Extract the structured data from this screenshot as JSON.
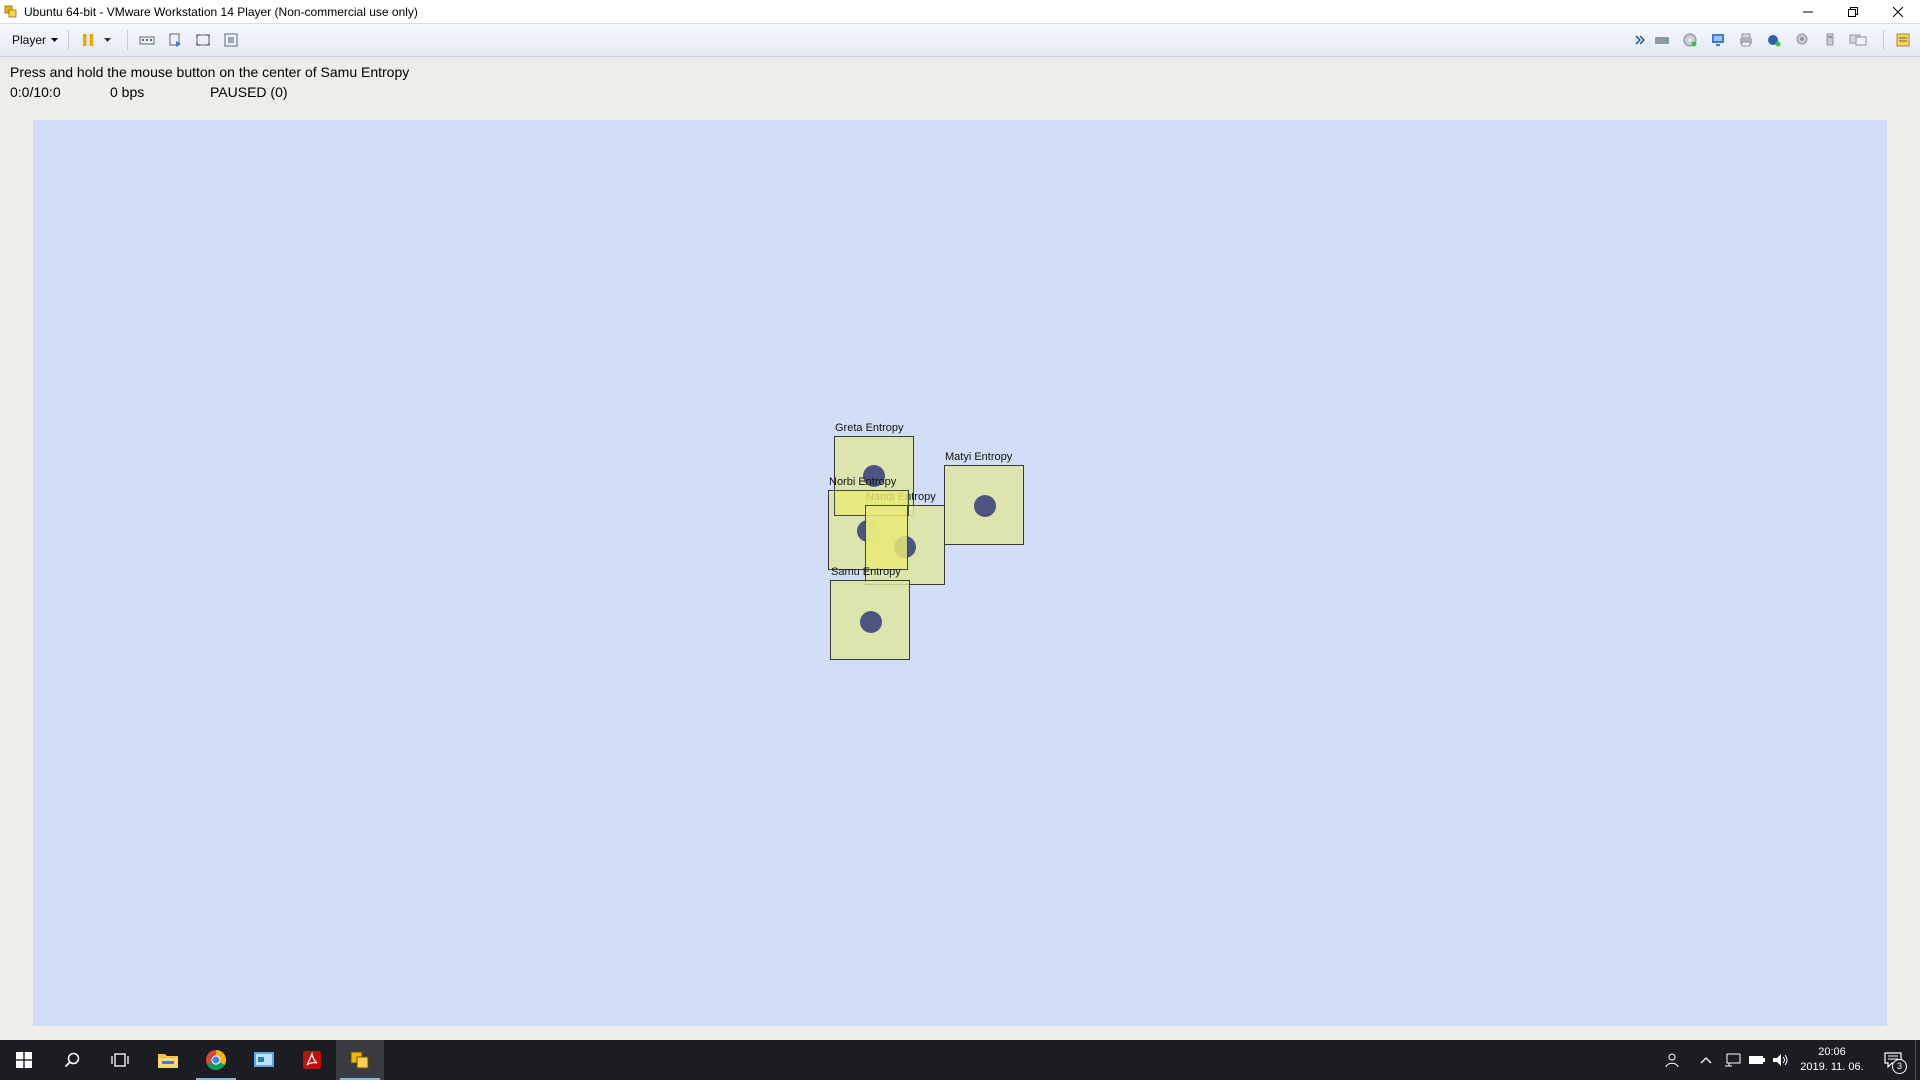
{
  "window": {
    "title": "Ubuntu 64-bit - VMware Workstation 14 Player (Non-commercial use only)"
  },
  "toolbar": {
    "player_label": "Player"
  },
  "status": {
    "instruction": "Press and hold the mouse button on the center of Samu Entropy",
    "time": "0:0/10:0",
    "bitrate": "0 bps",
    "state": "PAUSED (0)"
  },
  "arena": {
    "background": "#d2def5",
    "units": [
      {
        "name": "Greta  Entropy"
      },
      {
        "name": "Matyi  Entropy"
      },
      {
        "name": "Norbi  Entropy"
      },
      {
        "name": "Nandi  Entropy"
      },
      {
        "name": "Samu  Entropy"
      }
    ]
  },
  "taskbar": {
    "clock_time": "20:06",
    "clock_date": "2019. 11. 06.",
    "notification_count": "3"
  }
}
